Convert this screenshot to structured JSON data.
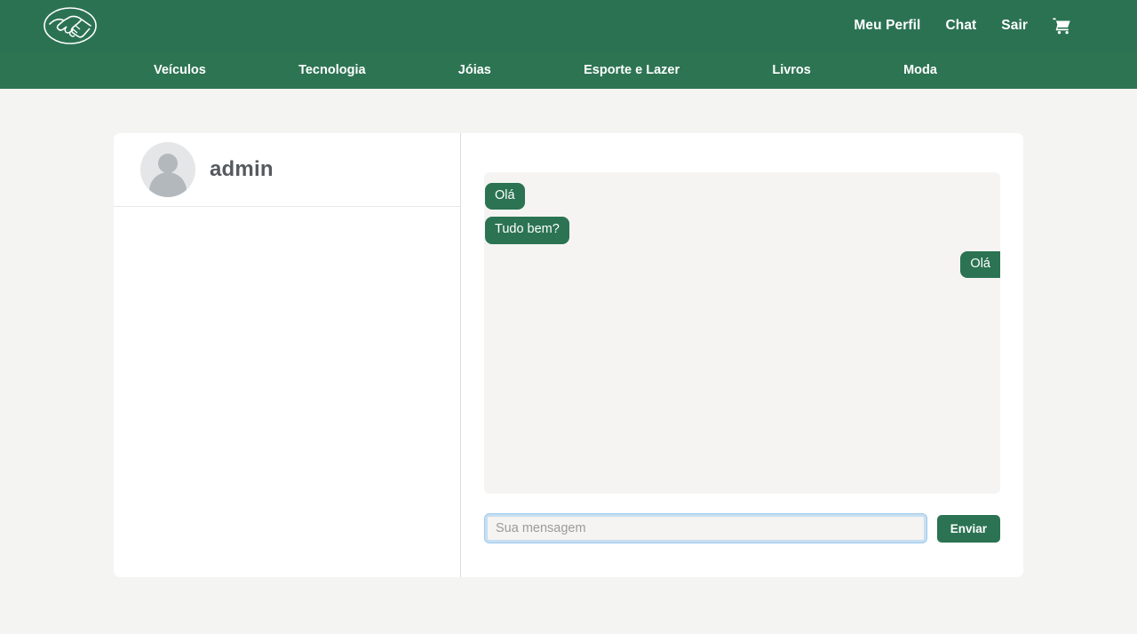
{
  "header": {
    "logo_alt": "handshake-logo",
    "nav": [
      {
        "label": "Meu Perfil"
      },
      {
        "label": "Chat"
      },
      {
        "label": "Sair"
      }
    ],
    "cart_icon": "shopping-cart-icon"
  },
  "categories": [
    {
      "label": "Veículos"
    },
    {
      "label": "Tecnologia"
    },
    {
      "label": "Jóias"
    },
    {
      "label": "Esporte e Lazer"
    },
    {
      "label": "Livros"
    },
    {
      "label": "Moda"
    }
  ],
  "sidebar": {
    "user": {
      "name": "admin",
      "avatar": "default-avatar-icon"
    }
  },
  "chat": {
    "messages": [
      {
        "text": "Olá",
        "side": "left"
      },
      {
        "text": "Tudo bem?",
        "side": "left"
      },
      {
        "text": "Olá",
        "side": "right"
      }
    ],
    "input": {
      "value": "",
      "placeholder": "Sua mensagem"
    },
    "send_label": "Enviar"
  },
  "colors": {
    "brand_green": "#2b7253",
    "nav_green": "#2d7453",
    "page_bg": "#f4f4f2",
    "chat_bg": "#f5f4f2",
    "focus_blue": "#9ec9ee"
  }
}
